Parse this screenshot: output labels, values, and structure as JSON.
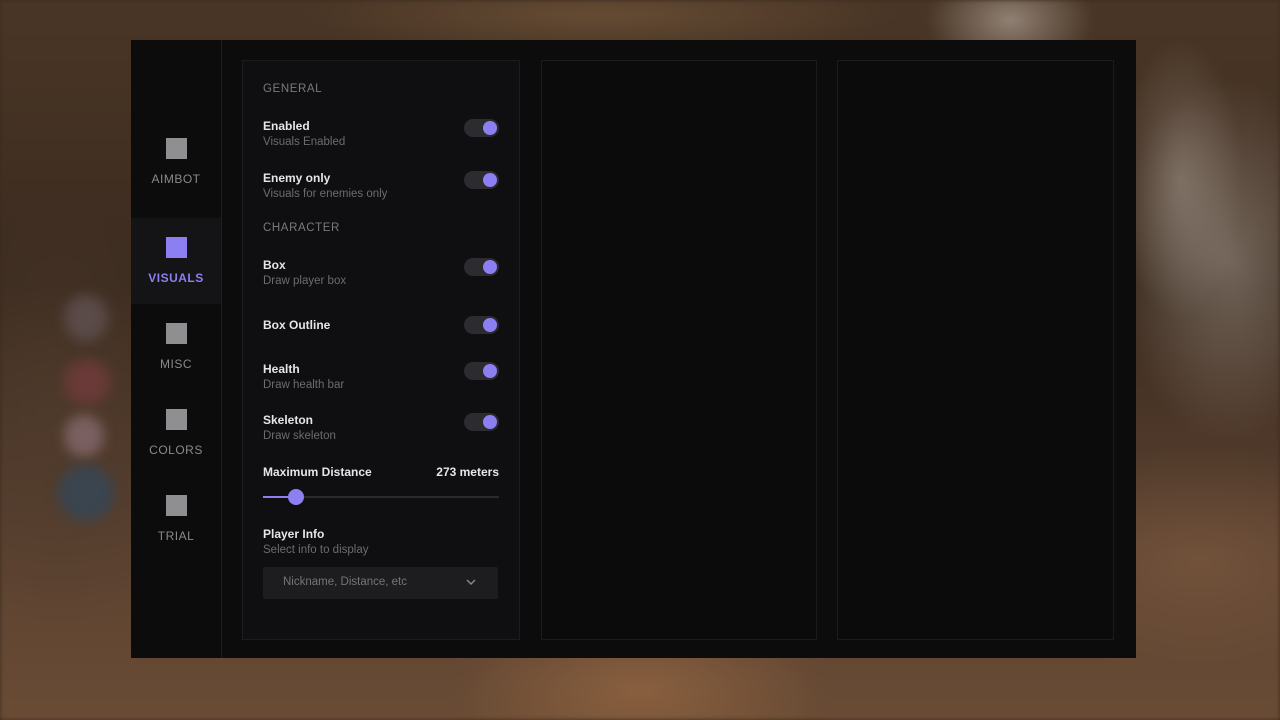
{
  "nav": [
    {
      "label": "AIMBOT",
      "active": false
    },
    {
      "label": "VISUALS",
      "active": true
    },
    {
      "label": "MISC",
      "active": false
    },
    {
      "label": "COLORS",
      "active": false
    },
    {
      "label": "TRIAL",
      "active": false
    }
  ],
  "general": {
    "heading": "GENERAL",
    "enabled": {
      "title": "Enabled",
      "desc": "Visuals Enabled",
      "on": true
    },
    "enemy_only": {
      "title": "Enemy only",
      "desc": "Visuals for enemies only",
      "on": true
    }
  },
  "character": {
    "heading": "CHARACTER",
    "box": {
      "title": "Box",
      "desc": "Draw player box",
      "on": true
    },
    "box_outline": {
      "title": "Box Outline",
      "on": true
    },
    "health": {
      "title": "Health",
      "desc": "Draw health bar",
      "on": true
    },
    "skeleton": {
      "title": "Skeleton",
      "desc": "Draw skeleton",
      "on": true
    },
    "max_distance": {
      "title": "Maximum Distance",
      "value_label": "273 meters",
      "fraction": 0.14
    },
    "player_info": {
      "title": "Player Info",
      "desc": "Select info to display",
      "selected": "Nickname, Distance, etc"
    }
  },
  "colors": {
    "accent": "#8c7ff2",
    "panel": "#0c0c0d",
    "toggle_track": "#2c2c30"
  },
  "icons": {
    "nav": "square-icon",
    "dropdown": "chevron-down-icon"
  }
}
